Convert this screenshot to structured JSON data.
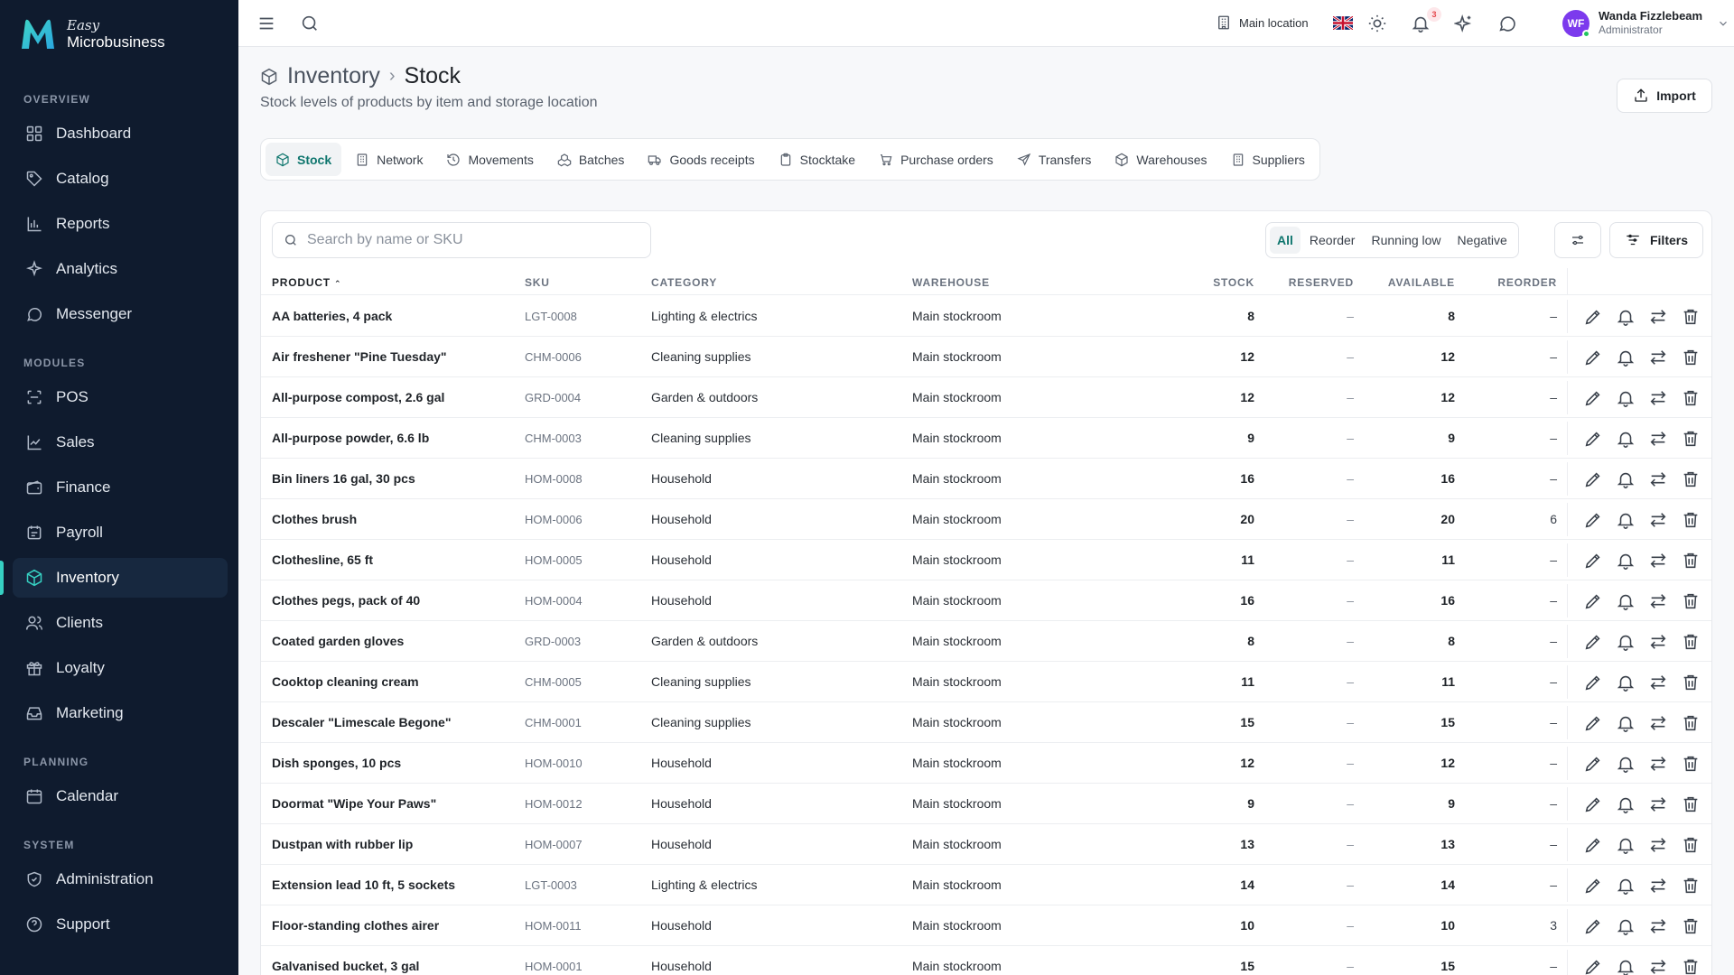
{
  "brand": {
    "easy": "Easy",
    "name": "Microbusiness"
  },
  "sidebar": {
    "sections": [
      {
        "label": "OVERVIEW"
      },
      {
        "label": "MODULES"
      },
      {
        "label": "PLANNING"
      },
      {
        "label": "SYSTEM"
      }
    ],
    "items": [
      {
        "label": "Dashboard",
        "icon": "dashboard-icon"
      },
      {
        "label": "Catalog",
        "icon": "tag-icon"
      },
      {
        "label": "Reports",
        "icon": "bar-chart-icon"
      },
      {
        "label": "Analytics",
        "icon": "sparkle-icon"
      },
      {
        "label": "Messenger",
        "icon": "chat-icon"
      },
      {
        "label": "POS",
        "icon": "scan-icon"
      },
      {
        "label": "Sales",
        "icon": "line-chart-icon"
      },
      {
        "label": "Finance",
        "icon": "wallet-icon"
      },
      {
        "label": "Payroll",
        "icon": "receipt-icon"
      },
      {
        "label": "Inventory",
        "icon": "box-icon",
        "active": true
      },
      {
        "label": "Clients",
        "icon": "users-icon"
      },
      {
        "label": "Loyalty",
        "icon": "gift-icon"
      },
      {
        "label": "Marketing",
        "icon": "inbox-icon"
      },
      {
        "label": "Calendar",
        "icon": "calendar-icon"
      },
      {
        "label": "Administration",
        "icon": "shield-icon"
      },
      {
        "label": "Support",
        "icon": "help-icon"
      }
    ]
  },
  "topbar": {
    "location": "Main location",
    "notifications_count": "3",
    "user": {
      "initials": "WF",
      "name": "Wanda Fizzlebeam",
      "role": "Administrator"
    }
  },
  "header": {
    "breadcrumb_parent": "Inventory",
    "breadcrumb_sep": "›",
    "title": "Stock",
    "subtitle": "Stock levels of products by item and storage location",
    "import_label": "Import"
  },
  "tabs": [
    {
      "label": "Stock",
      "icon": "box-icon",
      "active": true
    },
    {
      "label": "Network",
      "icon": "building-icon"
    },
    {
      "label": "Movements",
      "icon": "history-icon"
    },
    {
      "label": "Batches",
      "icon": "boxes-icon"
    },
    {
      "label": "Goods receipts",
      "icon": "truck-icon"
    },
    {
      "label": "Stocktake",
      "icon": "clipboard-icon"
    },
    {
      "label": "Purchase orders",
      "icon": "cart-icon"
    },
    {
      "label": "Transfers",
      "icon": "send-icon"
    },
    {
      "label": "Warehouses",
      "icon": "warehouse-icon"
    },
    {
      "label": "Suppliers",
      "icon": "building-icon"
    }
  ],
  "toolbar": {
    "search_placeholder": "Search by name or SKU",
    "segments": [
      {
        "label": "All",
        "active": true
      },
      {
        "label": "Reorder"
      },
      {
        "label": "Running low"
      },
      {
        "label": "Negative"
      }
    ],
    "filters_label": "Filters"
  },
  "table": {
    "columns": {
      "product": "PRODUCT",
      "product_sort": "⌃",
      "sku": "SKU",
      "category": "CATEGORY",
      "warehouse": "WAREHOUSE",
      "stock": "STOCK",
      "reserved": "RESERVED",
      "available": "AVAILABLE",
      "reorder": "REORDER"
    },
    "rows": [
      {
        "product": "AA batteries, 4 pack",
        "sku": "LGT-0008",
        "category": "Lighting & electrics",
        "warehouse": "Main stockroom",
        "stock": "8",
        "reserved": "–",
        "available": "8",
        "reorder": "–"
      },
      {
        "product": "Air freshener \"Pine Tuesday\"",
        "sku": "CHM-0006",
        "category": "Cleaning supplies",
        "warehouse": "Main stockroom",
        "stock": "12",
        "reserved": "–",
        "available": "12",
        "reorder": "–"
      },
      {
        "product": "All-purpose compost, 2.6 gal",
        "sku": "GRD-0004",
        "category": "Garden & outdoors",
        "warehouse": "Main stockroom",
        "stock": "12",
        "reserved": "–",
        "available": "12",
        "reorder": "–"
      },
      {
        "product": "All-purpose powder, 6.6 lb",
        "sku": "CHM-0003",
        "category": "Cleaning supplies",
        "warehouse": "Main stockroom",
        "stock": "9",
        "reserved": "–",
        "available": "9",
        "reorder": "–"
      },
      {
        "product": "Bin liners 16 gal, 30 pcs",
        "sku": "HOM-0008",
        "category": "Household",
        "warehouse": "Main stockroom",
        "stock": "16",
        "reserved": "–",
        "available": "16",
        "reorder": "–"
      },
      {
        "product": "Clothes brush",
        "sku": "HOM-0006",
        "category": "Household",
        "warehouse": "Main stockroom",
        "stock": "20",
        "reserved": "–",
        "available": "20",
        "reorder": "6"
      },
      {
        "product": "Clothesline, 65 ft",
        "sku": "HOM-0005",
        "category": "Household",
        "warehouse": "Main stockroom",
        "stock": "11",
        "reserved": "–",
        "available": "11",
        "reorder": "–"
      },
      {
        "product": "Clothes pegs, pack of 40",
        "sku": "HOM-0004",
        "category": "Household",
        "warehouse": "Main stockroom",
        "stock": "16",
        "reserved": "–",
        "available": "16",
        "reorder": "–"
      },
      {
        "product": "Coated garden gloves",
        "sku": "GRD-0003",
        "category": "Garden & outdoors",
        "warehouse": "Main stockroom",
        "stock": "8",
        "reserved": "–",
        "available": "8",
        "reorder": "–"
      },
      {
        "product": "Cooktop cleaning cream",
        "sku": "CHM-0005",
        "category": "Cleaning supplies",
        "warehouse": "Main stockroom",
        "stock": "11",
        "reserved": "–",
        "available": "11",
        "reorder": "–"
      },
      {
        "product": "Descaler \"Limescale Begone\"",
        "sku": "CHM-0001",
        "category": "Cleaning supplies",
        "warehouse": "Main stockroom",
        "stock": "15",
        "reserved": "–",
        "available": "15",
        "reorder": "–"
      },
      {
        "product": "Dish sponges, 10 pcs",
        "sku": "HOM-0010",
        "category": "Household",
        "warehouse": "Main stockroom",
        "stock": "12",
        "reserved": "–",
        "available": "12",
        "reorder": "–"
      },
      {
        "product": "Doormat \"Wipe Your Paws\"",
        "sku": "HOM-0012",
        "category": "Household",
        "warehouse": "Main stockroom",
        "stock": "9",
        "reserved": "–",
        "available": "9",
        "reorder": "–"
      },
      {
        "product": "Dustpan with rubber lip",
        "sku": "HOM-0007",
        "category": "Household",
        "warehouse": "Main stockroom",
        "stock": "13",
        "reserved": "–",
        "available": "13",
        "reorder": "–"
      },
      {
        "product": "Extension lead 10 ft, 5 sockets",
        "sku": "LGT-0003",
        "category": "Lighting & electrics",
        "warehouse": "Main stockroom",
        "stock": "14",
        "reserved": "–",
        "available": "14",
        "reorder": "–"
      },
      {
        "product": "Floor-standing clothes airer",
        "sku": "HOM-0011",
        "category": "Household",
        "warehouse": "Main stockroom",
        "stock": "10",
        "reserved": "–",
        "available": "10",
        "reorder": "3"
      },
      {
        "product": "Galvanised bucket, 3 gal",
        "sku": "HOM-0001",
        "category": "Household",
        "warehouse": "Main stockroom",
        "stock": "15",
        "reserved": "–",
        "available": "15",
        "reorder": "–"
      }
    ]
  },
  "colors": {
    "sidebar_bg": "#0f1b2e",
    "accent": "#0f766e",
    "accent_bright": "#36d0c2",
    "avatar": "#7c3aed"
  }
}
